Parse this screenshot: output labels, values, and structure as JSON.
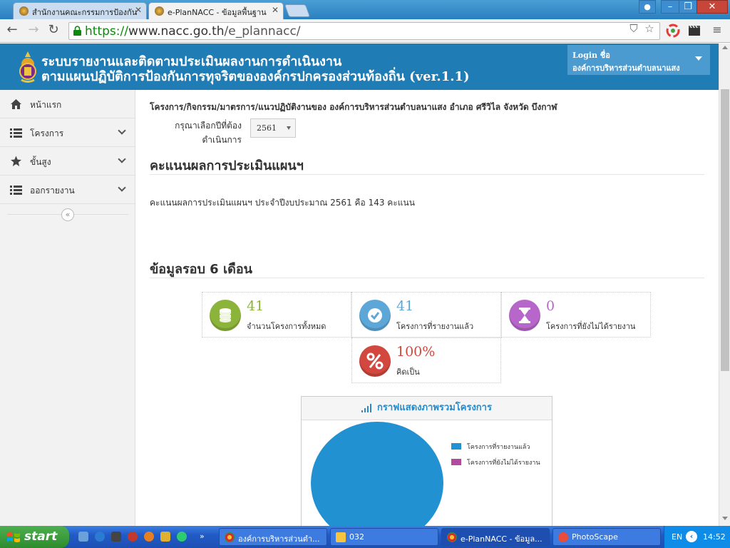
{
  "browser": {
    "tabs": [
      {
        "title": "สำนักงานคณะกรรมการป้องกัน"
      },
      {
        "title": "e-PlanNACC - ข้อมูลพื้นฐาน"
      }
    ],
    "url": {
      "scheme": "https://",
      "host": "www.nacc.go.th",
      "path": "/e_plannacc/"
    }
  },
  "header": {
    "title_line1": "ระบบรายงานและติดตามประเมินผลงานการดำเนินงาน",
    "title_line2": "ตามแผนปฏิบัติการป้องกันการทุจริตขององค์กรปกครองส่วนท้องถิ่น (ver.1.1)",
    "login_label": "Login ชื่อ",
    "login_name": "องค์การบริหารส่วนตำบลนาแสง"
  },
  "sidebar": {
    "items": [
      {
        "label": "หน้าแรก",
        "icon": "home-icon"
      },
      {
        "label": "โครงการ",
        "icon": "list-icon"
      },
      {
        "label": "ขั้นสูง",
        "icon": "star-icon"
      },
      {
        "label": "ออกรายงาน",
        "icon": "list-icon"
      }
    ],
    "collapse_glyph": "«"
  },
  "main": {
    "project_title": "โครงการ/กิจกรรม/มาตรการ/แนวปฏิบัติงานของ องค์การบริหารส่วนตำบลนาแสง อำเภอ ศรีวิไล จังหวัด บึงกาฬ",
    "year_label": "กรุณาเลือกปีที่ต้องดำเนินการ",
    "year_value": "2561",
    "score_heading": "คะแนนผลการประเมินแผนฯ",
    "score_text": "คะแนนผลการประเมินแผนฯ ประจำปีงบประมาณ 2561 คือ 143 คะแนน",
    "six_month_heading": "ข้อมูลรอบ 6 เดือน",
    "stats": [
      {
        "value": "41",
        "label": "จำนวนโครงการทั้งหมด",
        "color": "#8cb43a",
        "icon": "database-icon"
      },
      {
        "value": "41",
        "label": "โครงการที่รายงานแล้ว",
        "color": "#5da7d8",
        "icon": "check-icon"
      },
      {
        "value": "0",
        "label": "โครงการที่ยังไม่ได้รายงาน",
        "color": "#b667c9",
        "icon": "hourglass-icon"
      },
      {
        "value": "100%",
        "label": "คิดเป็น",
        "color": "#d2483e",
        "icon": "percent-icon"
      }
    ],
    "chart_title": "กราฟแสดงภาพรวมโครงการ"
  },
  "chart_data": {
    "type": "pie",
    "title": "กราฟแสดงภาพรวมโครงการ",
    "categories": [
      "โครงการที่รายงานแล้ว",
      "โครงการที่ยังไม่ได้รายงาน"
    ],
    "values": [
      41,
      0
    ],
    "colors": [
      "#2191d1",
      "#b24aa0"
    ],
    "legend": "right"
  },
  "taskbar": {
    "start_label": "start",
    "tasks": [
      {
        "label": "องค์การบริหารส่วนตำ..."
      },
      {
        "label": "032"
      },
      {
        "label": "e-PlanNACC - ข้อมูล..."
      },
      {
        "label": "PhotoScape"
      }
    ],
    "language": "EN",
    "clock": "14:52"
  }
}
